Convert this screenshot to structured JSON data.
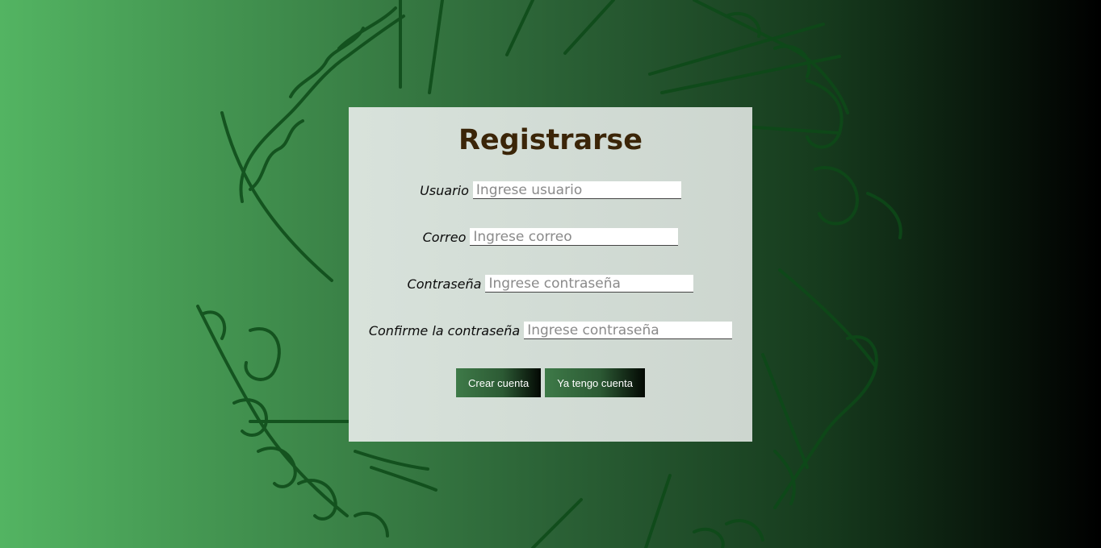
{
  "form": {
    "title": "Registrarse",
    "fields": [
      {
        "label": "Usuario",
        "placeholder": "Ingrese usuario",
        "value": ""
      },
      {
        "label": "Correo",
        "placeholder": "Ingrese correo",
        "value": ""
      },
      {
        "label": "Contraseña",
        "placeholder": "Ingrese contraseña",
        "value": ""
      },
      {
        "label": "Confirme la contraseña",
        "placeholder": "Ingrese contraseña",
        "value": ""
      }
    ],
    "buttons": {
      "create": "Crear cuenta",
      "have_account": "Ya tengo cuenta"
    }
  },
  "background": {
    "decoration": "one-ring-inscription"
  }
}
